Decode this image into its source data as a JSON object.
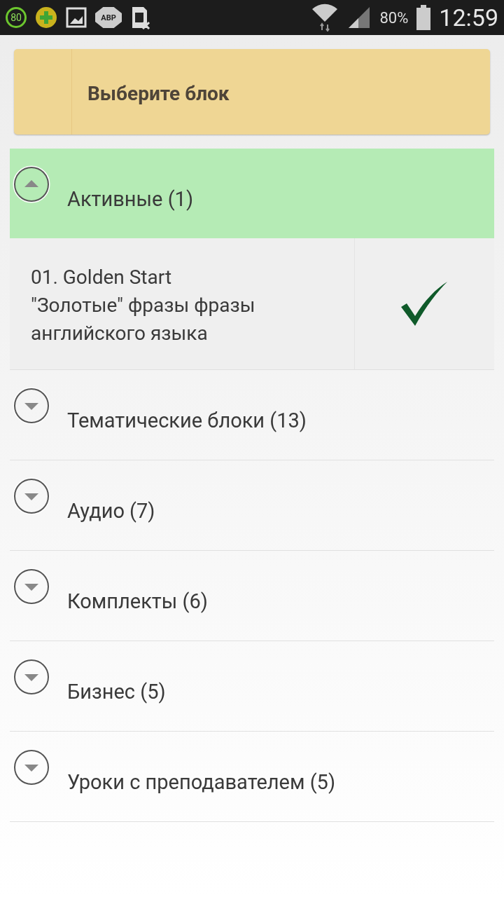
{
  "status_bar": {
    "battery_badge": "80",
    "adblock_badge": "ABP",
    "battery_percent": "80%",
    "time": "12:59"
  },
  "header": {
    "title": "Выберите блок"
  },
  "groups": [
    {
      "label": "Активные (1)",
      "expanded": true,
      "children": [
        {
          "title": "01. Golden Start",
          "subtitle": "\"Золотые\" фразы фразы английского языка",
          "checked": true
        }
      ]
    },
    {
      "label": "Тематические блоки (13)",
      "expanded": false
    },
    {
      "label": "Аудио (7)",
      "expanded": false
    },
    {
      "label": "Комплекты (6)",
      "expanded": false
    },
    {
      "label": "Бизнес (5)",
      "expanded": false
    },
    {
      "label": "Уроки с преподавателем (5)",
      "expanded": false
    }
  ]
}
